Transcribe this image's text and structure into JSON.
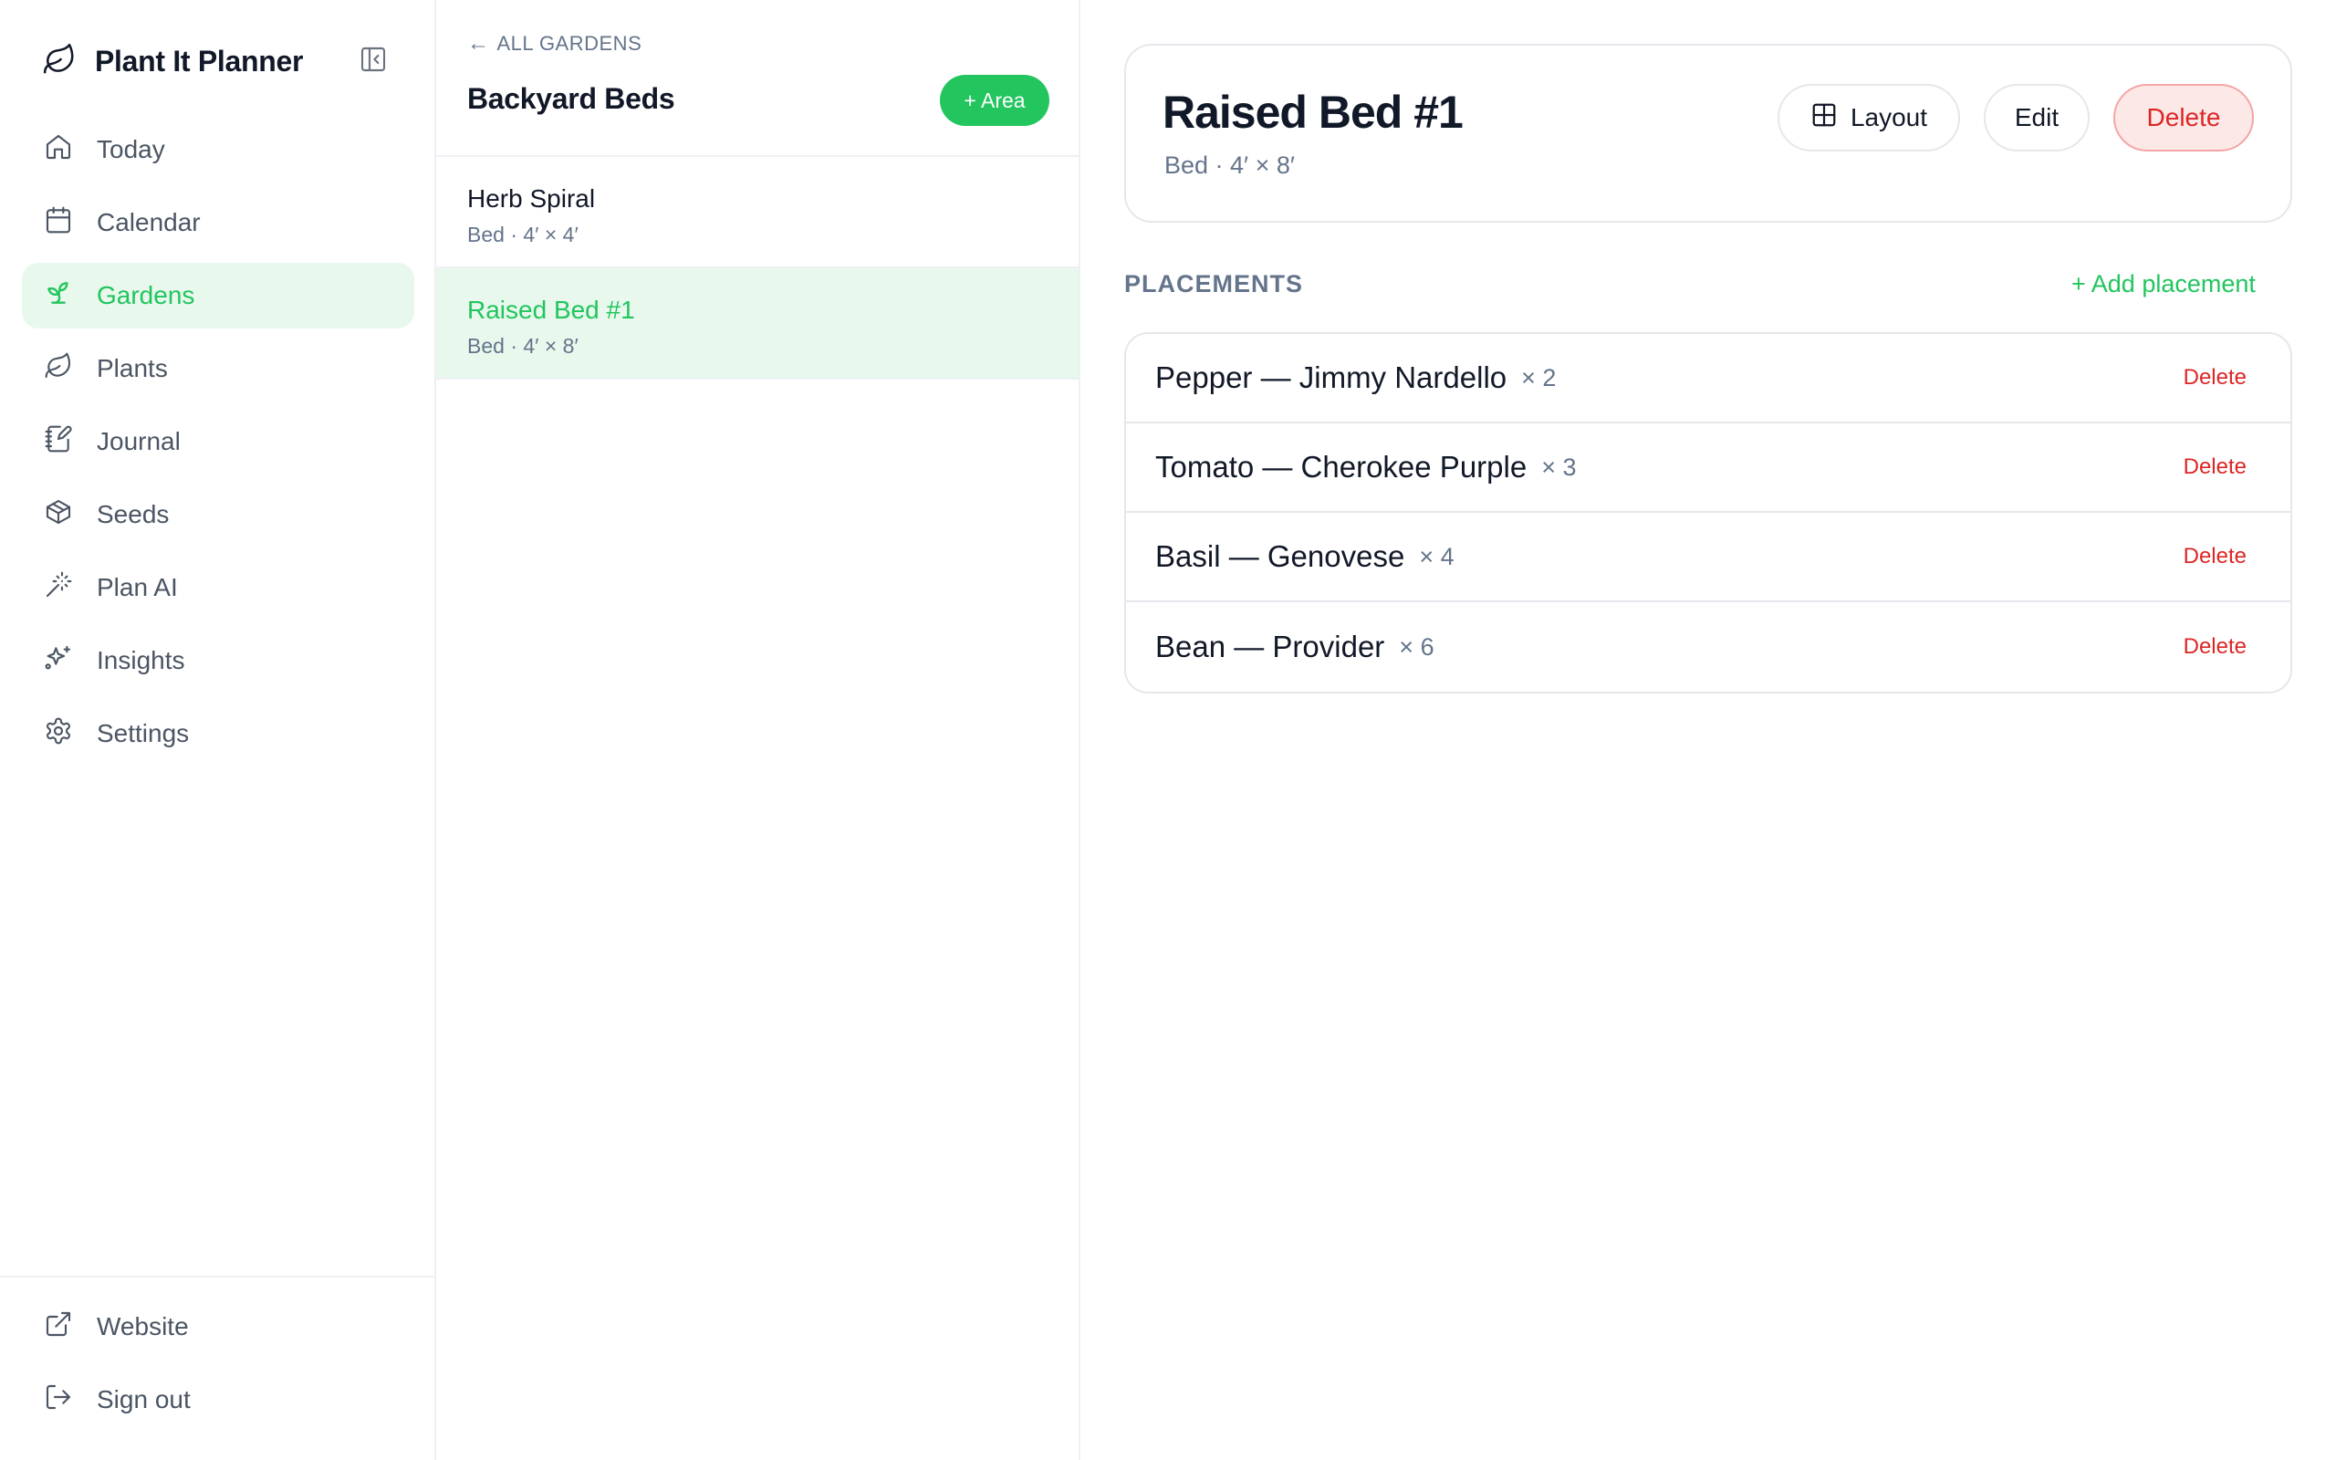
{
  "app": {
    "name": "Plant It Planner"
  },
  "sidebar": {
    "items": [
      {
        "label": "Today",
        "icon": "home-icon"
      },
      {
        "label": "Calendar",
        "icon": "calendar-icon"
      },
      {
        "label": "Gardens",
        "icon": "sprout-icon",
        "active": true
      },
      {
        "label": "Plants",
        "icon": "leaf-icon"
      },
      {
        "label": "Journal",
        "icon": "notebook-pen-icon"
      },
      {
        "label": "Seeds",
        "icon": "package-icon"
      },
      {
        "label": "Plan AI",
        "icon": "wand-icon"
      },
      {
        "label": "Insights",
        "icon": "sparkles-icon"
      },
      {
        "label": "Settings",
        "icon": "gear-icon"
      }
    ],
    "bottom": [
      {
        "label": "Website",
        "icon": "external-link-icon"
      },
      {
        "label": "Sign out",
        "icon": "log-out-icon"
      }
    ]
  },
  "garden": {
    "back_label": "ALL GARDENS",
    "title": "Backyard Beds",
    "add_area_label": "+ Area",
    "areas": [
      {
        "name": "Herb Spiral",
        "meta": "Bed · 4′ × 4′"
      },
      {
        "name": "Raised Bed #1",
        "meta": "Bed · 4′ × 8′",
        "active": true
      }
    ]
  },
  "detail": {
    "title": "Raised Bed #1",
    "meta": "Bed · 4′ × 8′",
    "layout_label": "Layout",
    "edit_label": "Edit",
    "delete_label": "Delete",
    "placements_label": "PLACEMENTS",
    "add_placement_label": "+ Add placement",
    "placements": [
      {
        "name": "Pepper — Jimmy Nardello",
        "qty": "× 2",
        "delete": "Delete"
      },
      {
        "name": "Tomato — Cherokee Purple",
        "qty": "× 3",
        "delete": "Delete"
      },
      {
        "name": "Basil — Genovese",
        "qty": "× 4",
        "delete": "Delete"
      },
      {
        "name": "Bean — Provider",
        "qty": "× 6",
        "delete": "Delete"
      }
    ]
  },
  "colors": {
    "accent": "#22c55e",
    "accent_bg": "#e8f8ed",
    "danger": "#dc2626",
    "danger_bg": "#fde8e8",
    "muted": "#64748b"
  }
}
